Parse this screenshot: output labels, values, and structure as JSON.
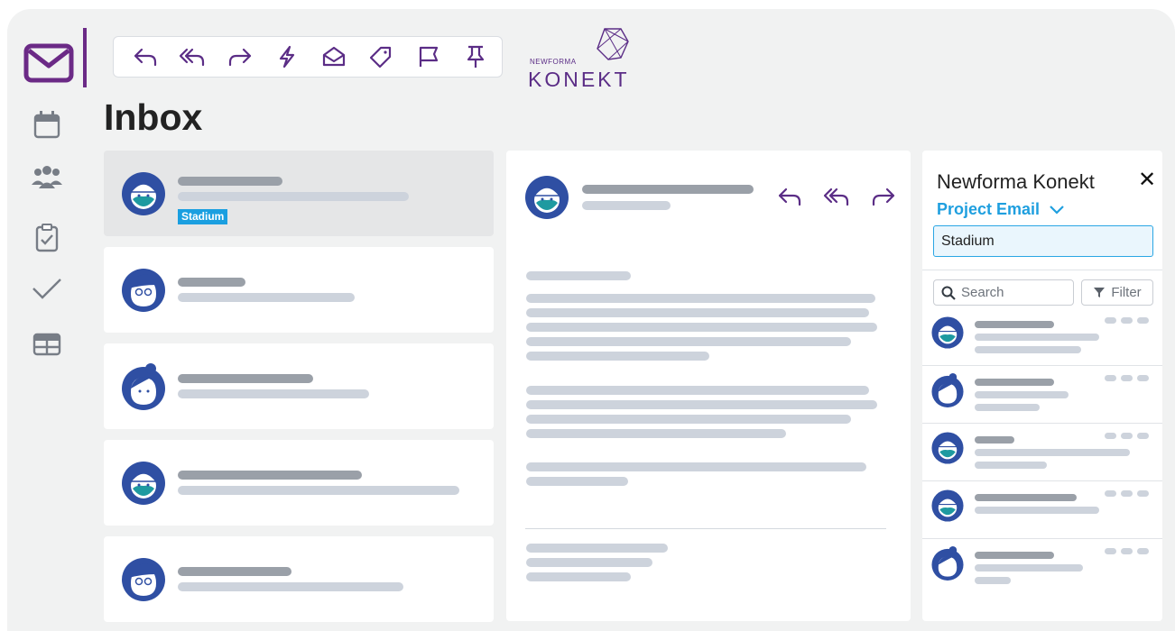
{
  "app": {
    "logo_top": "NEWFORMA",
    "logo_main": "KONEKT"
  },
  "icons": {
    "mail": "mail-icon",
    "calendar": "calendar-icon",
    "people": "people-icon",
    "clipboard": "clipboard-check-icon",
    "check": "check-icon",
    "table": "table-icon",
    "toolbar": [
      "reply-icon",
      "reply-all-icon",
      "forward-icon",
      "lightning-icon",
      "mark-read-icon",
      "tag-icon",
      "flag-icon",
      "pin-icon"
    ]
  },
  "colors": {
    "brand_purple": "#6b2a86",
    "accent_blue": "#1f9fdf",
    "tag_blue": "#1a9fe0"
  },
  "inbox": {
    "title": "Inbox",
    "emails": [
      {
        "avatar": "construction-worker-avatar",
        "tag": "Stadium",
        "selected": true
      },
      {
        "avatar": "glasses-woman-avatar"
      },
      {
        "avatar": "bun-woman-avatar"
      },
      {
        "avatar": "construction-worker-avatar"
      },
      {
        "avatar": "glasses-woman-avatar"
      }
    ]
  },
  "panel": {
    "title": "Newforma Konekt",
    "close": "✕",
    "subtitle": "Project Email",
    "project_value": "Stadium",
    "search_placeholder": "Search",
    "filter_label": "Filter"
  }
}
